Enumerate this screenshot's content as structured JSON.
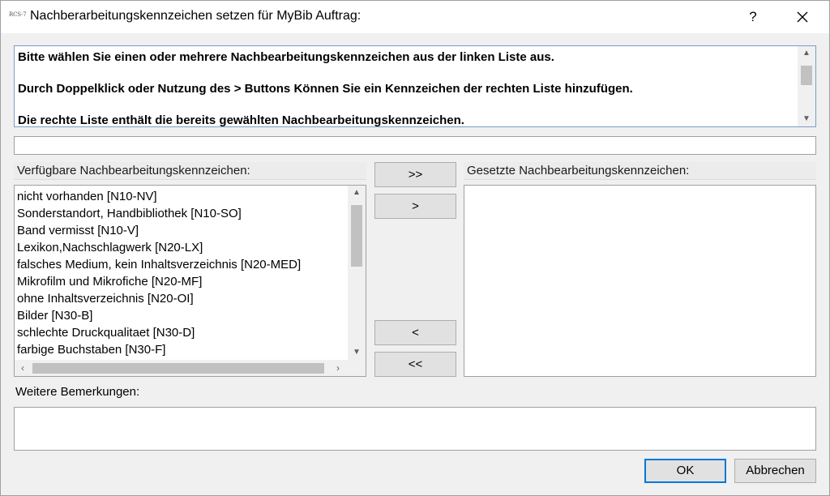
{
  "window": {
    "icon_text": "RCS-7",
    "title": "Nachberarbeitungskennzeichen setzen für MyBib Auftrag:",
    "help_label": "?"
  },
  "info": {
    "lines": [
      "Bitte wählen Sie einen oder mehrere Nachbearbeitungskennzeichen aus der linken Liste aus.",
      "Durch Doppelklick oder Nutzung des > Buttons Können Sie ein Kennzeichen der rechten Liste hinzufügen.",
      "Die rechte Liste enthält die bereits gewählten Nachbearbeitungskennzeichen."
    ]
  },
  "filter": {
    "value": ""
  },
  "available": {
    "label": "Verfügbare Nachbearbeitungskennzeichen:",
    "items": [
      "nicht vorhanden  [N10-NV]",
      "Sonderstandort, Handbibliothek  [N10-SO]",
      "Band vermisst  [N10-V]",
      "Lexikon,Nachschlagwerk  [N20-LX]",
      "falsches Medium, kein Inhaltsverzeichnis  [N20-MED]",
      "Mikrofilm und Mikrofiche  [N20-MF]",
      "ohne Inhaltsverzeichnis  [N20-OI]",
      "Bilder  [N30-B]",
      "schlechte Druckqualitaet  [N30-D]",
      "farbige Buchstaben  [N30-F]"
    ]
  },
  "selected": {
    "label": "Gesetzte Nachbearbeitungskennzeichen:",
    "items": []
  },
  "move_buttons": {
    "add_all": ">>",
    "add": ">",
    "remove": "<",
    "remove_all": "<<"
  },
  "remarks": {
    "label": "Weitere Bemerkungen:",
    "value": ""
  },
  "footer": {
    "ok_label": "OK",
    "cancel_label": "Abbrechen"
  },
  "colors": {
    "focus_border": "#0078d7",
    "info_border": "#7a9cc6"
  }
}
